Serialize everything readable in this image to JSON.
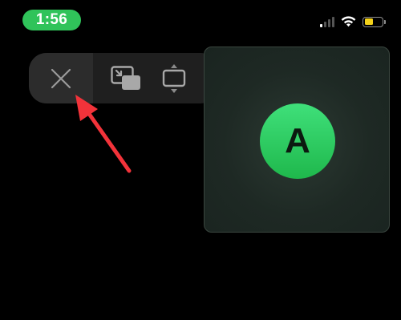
{
  "status_bar": {
    "time": "1:56",
    "time_pill_color": "#30c35a",
    "battery_color": "#f4d21a",
    "battery_level": 0.5,
    "icons": [
      "signal-icon",
      "wifi-icon",
      "battery-icon"
    ]
  },
  "pip_toolbar": {
    "buttons": [
      {
        "icon": "close-icon"
      },
      {
        "icon": "return-to-app-icon"
      },
      {
        "icon": "resize-icon"
      }
    ]
  },
  "pip_window": {
    "avatar_letter": "A",
    "avatar_color": "#2ccb5f"
  },
  "annotation": {
    "arrow_color": "#f2333a",
    "points_to": "close-icon"
  }
}
